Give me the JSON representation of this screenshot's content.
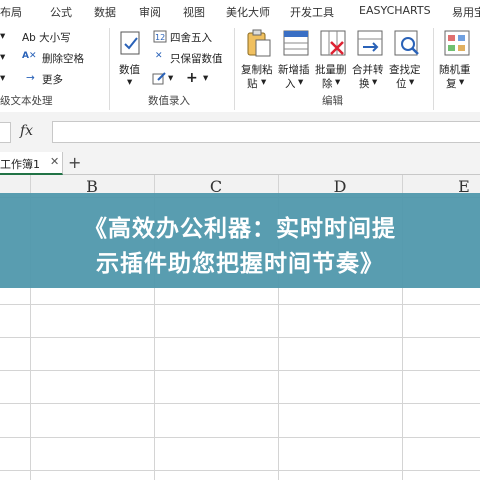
{
  "menu": [
    "布局",
    "公式",
    "数据",
    "审阅",
    "视图",
    "美化大师",
    "开发工具",
    "EASYCHARTS",
    "易用宝"
  ],
  "ribbon": {
    "text_group": {
      "items": [
        "Ab 大小写",
        "删除空格",
        "更多"
      ],
      "label": "级文本处理"
    },
    "number_group": {
      "value_button": "数值",
      "round": "四舍五入",
      "keep_value": "只保留数值",
      "label": "数值录入"
    },
    "edit_group": {
      "buttons": [
        {
          "l1": "复制粘",
          "l2": "贴"
        },
        {
          "l1": "新增插",
          "l2": "入"
        },
        {
          "l1": "批量删",
          "l2": "除"
        },
        {
          "l1": "合并转",
          "l2": "换"
        },
        {
          "l1": "查找定",
          "l2": "位"
        }
      ],
      "label": "编辑"
    },
    "random_group": {
      "l1": "随机重",
      "l2": "复"
    }
  },
  "formula_bar": {
    "fx": "fx",
    "value": ""
  },
  "sheet_tab": {
    "name": "工作簿1"
  },
  "columns": [
    "B",
    "C",
    "D",
    "E"
  ],
  "banner": {
    "line1": "《高效办公利器：实时时间提",
    "line2": "示插件助您把握时间节奏》"
  }
}
